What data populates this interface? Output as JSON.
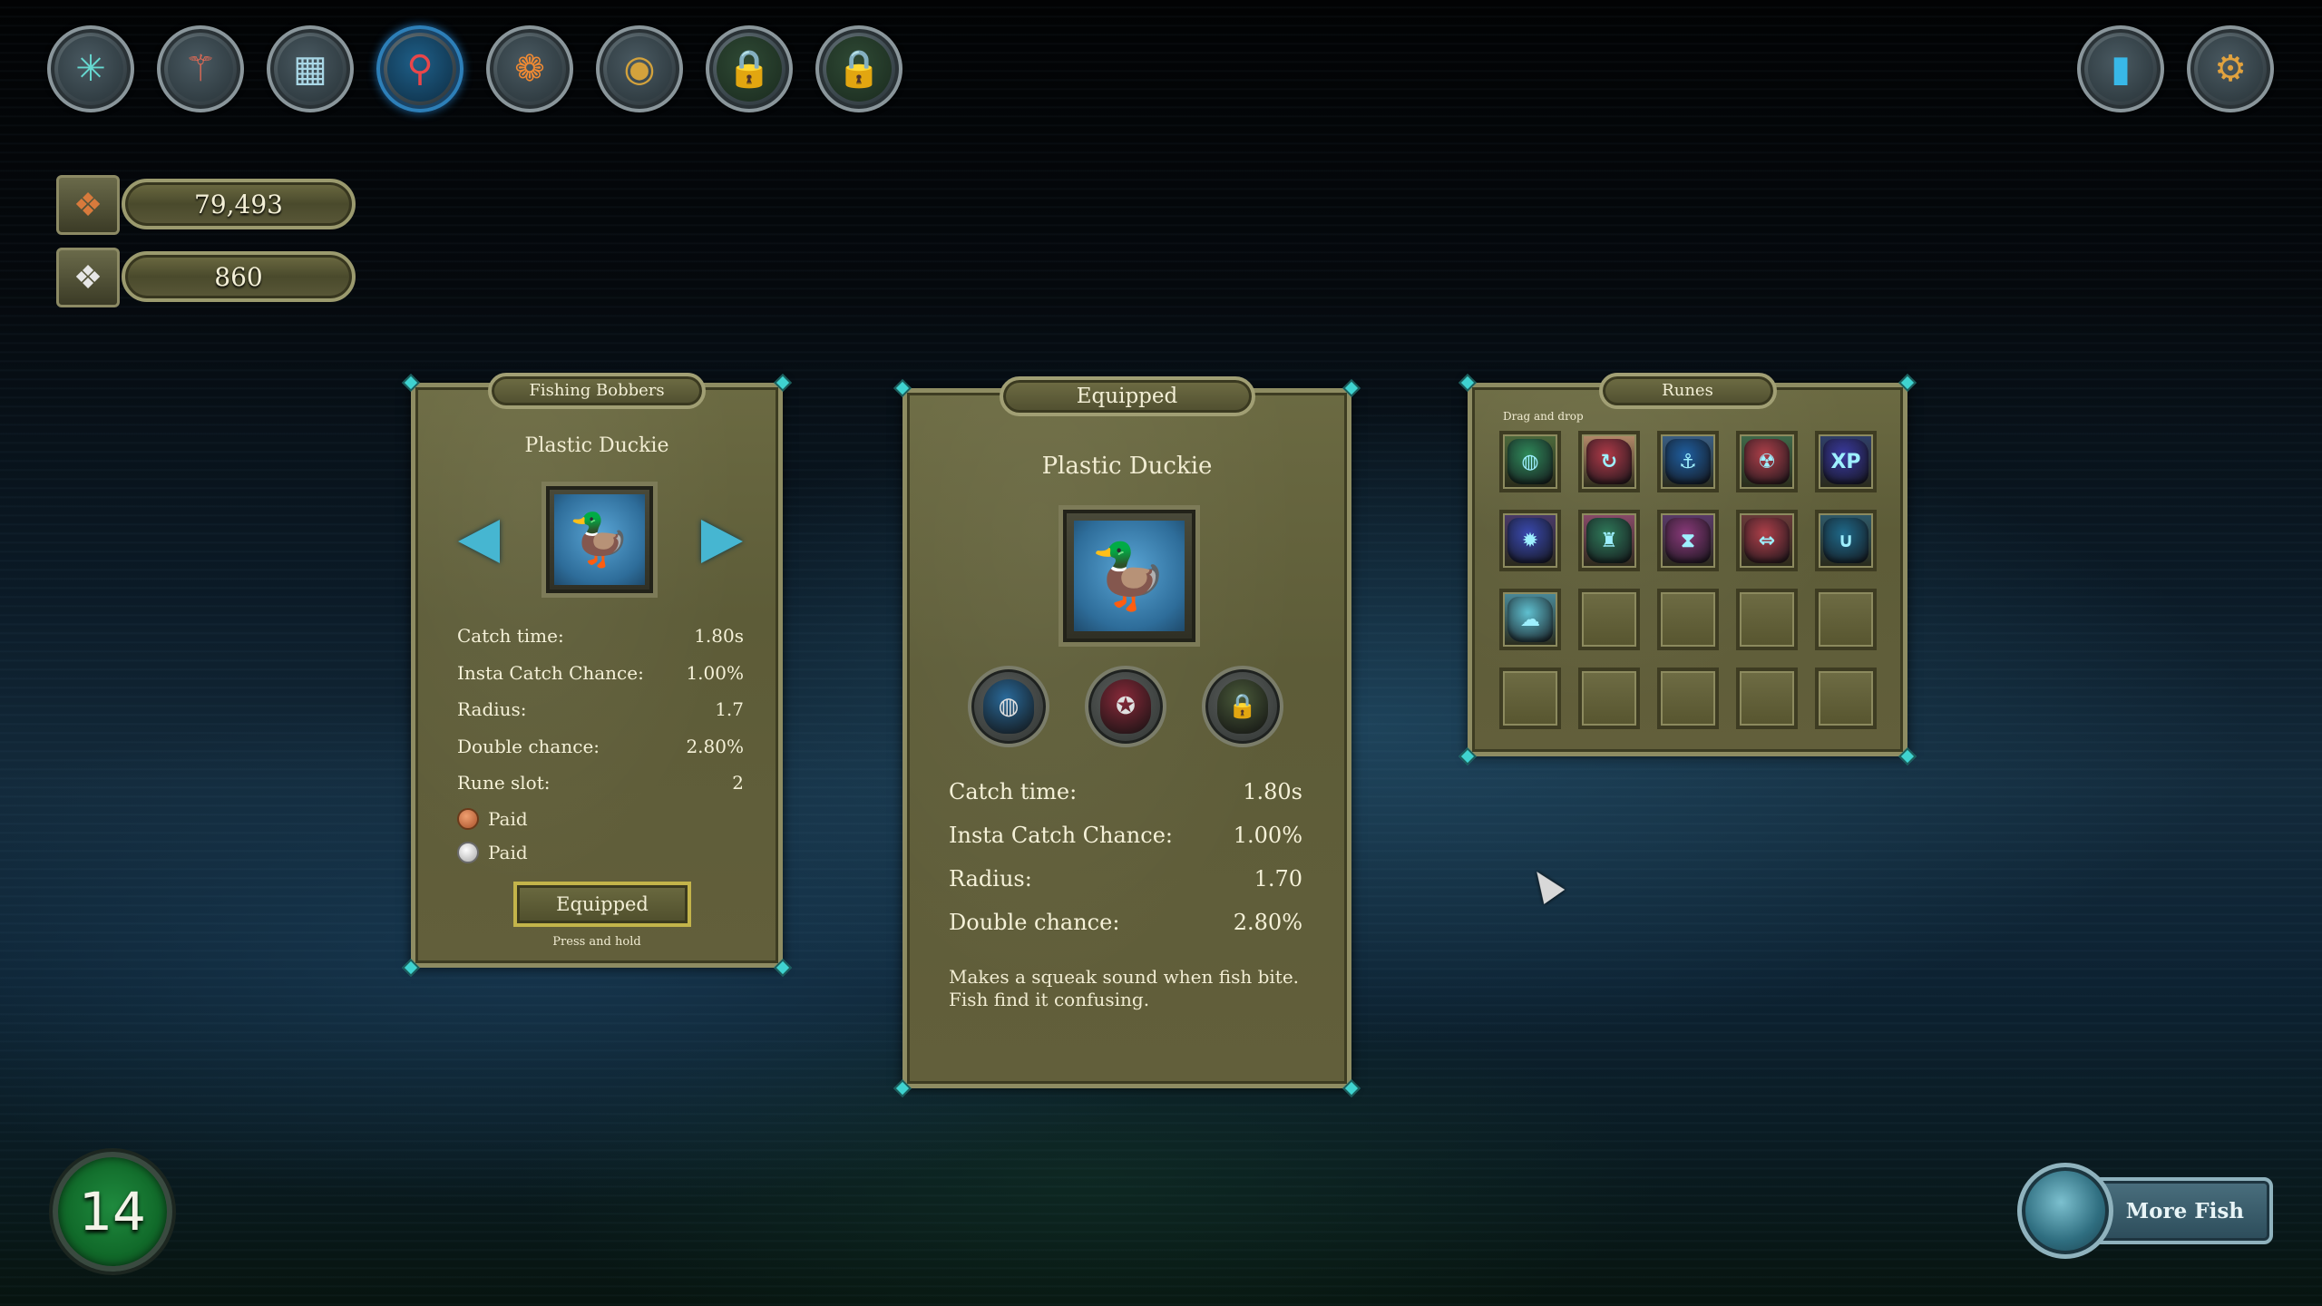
{
  "toolbar": {
    "buttons": [
      {
        "name": "skill-tree-icon",
        "glyph": "✳",
        "color": "#66d8d0"
      },
      {
        "name": "fishing-rod-icon",
        "glyph": "⚚",
        "color": "#e46a54"
      },
      {
        "name": "map-icon",
        "glyph": "▦",
        "color": "#a9d7e6"
      },
      {
        "name": "bobber-icon",
        "glyph": "⚲",
        "color": "#e9464a",
        "active": true
      },
      {
        "name": "clownfish-icon",
        "glyph": "❁",
        "color": "#f08a33"
      },
      {
        "name": "compass-icon",
        "glyph": "◉",
        "color": "#d3a23c"
      },
      {
        "name": "lock-icon",
        "glyph": "🔒",
        "color": "#4caa5a",
        "locked": true
      },
      {
        "name": "lock-icon",
        "glyph": "🔒",
        "color": "#4caa5a",
        "locked": true
      }
    ],
    "right": [
      {
        "name": "stats-chart-icon",
        "glyph": "▮",
        "color": "#38b8e8"
      },
      {
        "name": "settings-gear-icon",
        "glyph": "⚙",
        "color": "#e1a23e"
      }
    ]
  },
  "currency": {
    "copper": "79,493",
    "silver": "860"
  },
  "bobbers_panel": {
    "title": "Fishing Bobbers",
    "item_name": "Plastic Duckie",
    "stats": [
      {
        "label": "Catch time:",
        "value": "1.80s"
      },
      {
        "label": "Insta Catch Chance:",
        "value": "1.00%"
      },
      {
        "label": "Radius:",
        "value": "1.7"
      },
      {
        "label": "Double chance:",
        "value": "2.80%"
      },
      {
        "label": "Rune slot:",
        "value": "2"
      }
    ],
    "paid_copper": "Paid",
    "paid_silver": "Paid",
    "equipped_label": "Equipped",
    "hint": "Press and hold"
  },
  "equipped_panel": {
    "title": "Equipped",
    "item_name": "Plastic Duckie",
    "stats": [
      {
        "label": "Catch time:",
        "value": "1.80s"
      },
      {
        "label": "Insta Catch Chance:",
        "value": "1.00%"
      },
      {
        "label": "Radius:",
        "value": "1.70"
      },
      {
        "label": "Double chance:",
        "value": "2.80%"
      }
    ],
    "description_line1": "Makes a squeak sound when fish bite.",
    "description_line2": "Fish find it confusing."
  },
  "runes_panel": {
    "title": "Runes",
    "hint": "Drag and drop",
    "runes": [
      {
        "name": "rune-green-drop-icon",
        "bg": "#4d6a3c",
        "gem": "#2f8a5a",
        "glyph": "◍"
      },
      {
        "name": "rune-red-cycle-icon",
        "bg": "#b58a6a",
        "gem": "#b03a48",
        "glyph": "↻"
      },
      {
        "name": "rune-blue-anchor-icon",
        "bg": "#3a5f85",
        "gem": "#1f5fa0",
        "glyph": "⚓"
      },
      {
        "name": "rune-gold-radiation-icon",
        "bg": "#3f6a4a",
        "gem": "#b0404a",
        "glyph": "☢"
      },
      {
        "name": "rune-xp-icon",
        "bg": "#2f3f6a",
        "gem": "#3a3aa0",
        "glyph": "XP"
      },
      {
        "name": "rune-purple-gear-icon",
        "bg": "#4a3a6a",
        "gem": "#3a4ab0",
        "glyph": "✹"
      },
      {
        "name": "rune-pink-tower-icon",
        "bg": "#8a4a6a",
        "gem": "#2f7a5a",
        "glyph": "♜"
      },
      {
        "name": "rune-hourglass-icon",
        "bg": "#5a3a6a",
        "gem": "#8a3a7a",
        "glyph": "⧗"
      },
      {
        "name": "rune-red-arrows-icon",
        "bg": "#6a3a3a",
        "gem": "#b0404a",
        "glyph": "⇔"
      },
      {
        "name": "rune-magnet-icon",
        "bg": "#2f5a6a",
        "gem": "#1f6a8a",
        "glyph": "∪"
      },
      {
        "name": "rune-cyan-ghost-icon",
        "bg": "#4a8a9a",
        "gem": "#5fc0d0",
        "glyph": "☁"
      }
    ],
    "total_slots": 20
  },
  "equipped_sockets": [
    {
      "name": "rune-socket-blue-icon",
      "color": "#2a6a9a",
      "glyph": "◍"
    },
    {
      "name": "rune-socket-red-icon",
      "color": "#8a2a3a",
      "glyph": "✪"
    },
    {
      "name": "rune-socket-locked-icon",
      "color": "#4a5a3a",
      "glyph": "🔒"
    }
  ],
  "player": {
    "level": "14"
  },
  "more_fish_label": "More Fish"
}
